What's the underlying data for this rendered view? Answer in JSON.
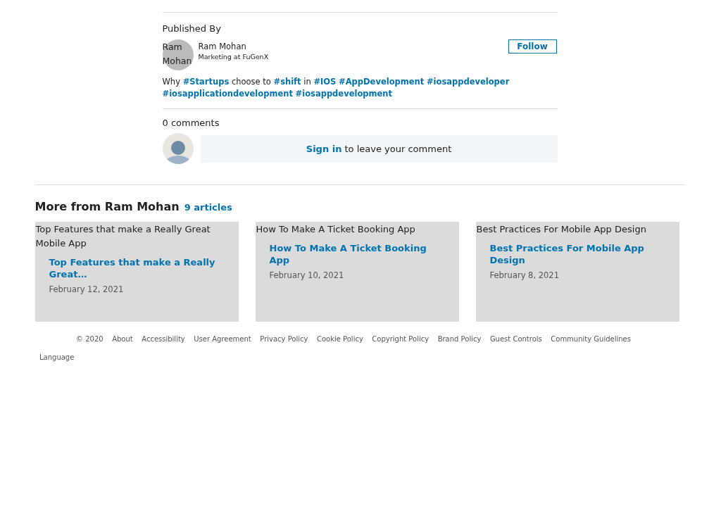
{
  "publisher": {
    "heading": "Published By",
    "avatar_alt": "Ram Mohan",
    "name": "Ram Mohan",
    "headline": "Marketing at FuGenX",
    "follow_button": "Follow",
    "post_text": "Why **#Startups** choose to **#shift** in **#IOS** **#AppDevelopment** **#iosappdeveloper** **#iosapplicationdevelopment** **#iosappdevelopment**"
  },
  "comments": {
    "count": "0 comments",
    "prompt": "**Sign in** to leave your comment"
  },
  "more": {
    "title": "More from Ram Mohan",
    "count_link": "9 articles",
    "articles": [
      {
        "image_alt": "Top Features that make a Really Great Mobile App",
        "title": "Top Features that make a Really Great…",
        "date": "February 12, 2021"
      },
      {
        "image_alt": "How To Make A Ticket Booking App",
        "title": "How To Make A Ticket Booking App",
        "date": "February 10, 2021"
      },
      {
        "image_alt": "Best Practices For Mobile App Design",
        "title": "Best Practices For Mobile App Design",
        "date": "February 8, 2021"
      }
    ]
  },
  "footer": {
    "links": [
      "© 2020",
      "About",
      "Accessibility",
      "User Agreement",
      "Privacy Policy",
      "Cookie Policy",
      "Copyright Policy",
      "Brand Policy",
      "Guest Controls",
      "Community Guidelines"
    ],
    "language": "Language"
  }
}
